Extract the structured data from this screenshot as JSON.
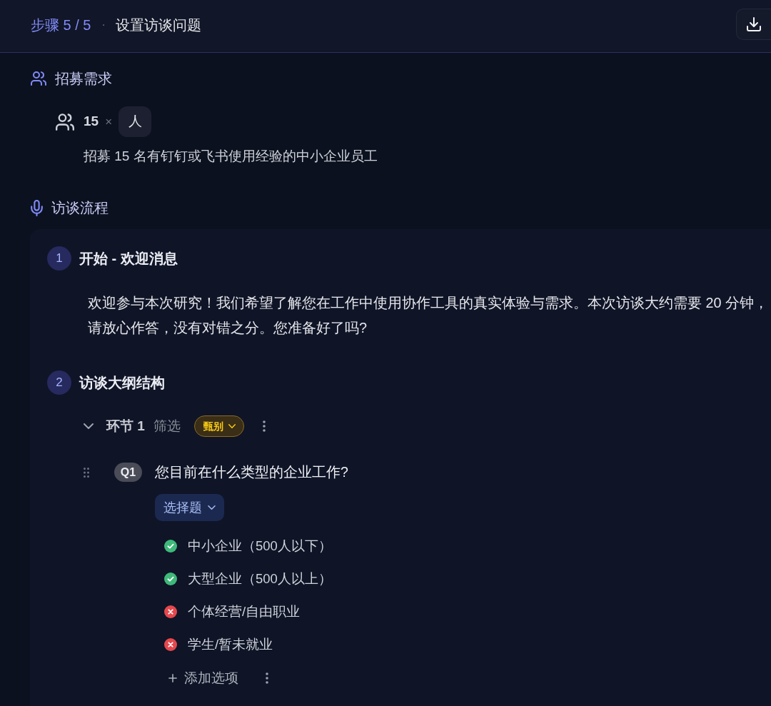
{
  "header": {
    "step_label": "步骤 5 / 5",
    "separator": "·",
    "title": "设置访谈问题"
  },
  "recruitment": {
    "heading": "招募需求",
    "count": "15",
    "times": "×",
    "unit": "人",
    "description": "招募 15 名有钉钉或飞书使用经验的中小企业员工"
  },
  "interview_flow": {
    "heading": "访谈流程",
    "steps": [
      {
        "number": "1",
        "title": "开始 - 欢迎消息",
        "kind": "message",
        "message": "欢迎参与本次研究！我们希望了解您在工作中使用协作工具的真实体验与需求。本次访谈大约需要 20 分钟，请放心作答，没有对错之分。您准备好了吗?"
      },
      {
        "number": "2",
        "title": "访谈大纲结构",
        "kind": "outline",
        "sections": [
          {
            "label": "环节 1",
            "name": "筛选",
            "tag": "甄别",
            "expanded": true,
            "questions": [
              {
                "label": "Q1",
                "text": "您目前在什么类型的企业工作?",
                "type": "选择题",
                "options": [
                  {
                    "text": "中小企业（500人以下）",
                    "accepted": true
                  },
                  {
                    "text": "大型企业（500人以上）",
                    "accepted": true
                  },
                  {
                    "text": "个体经营/自由职业",
                    "accepted": false
                  },
                  {
                    "text": "学生/暂未就业",
                    "accepted": false
                  }
                ],
                "add_option": "添加选项"
              }
            ]
          }
        ]
      }
    ]
  }
}
